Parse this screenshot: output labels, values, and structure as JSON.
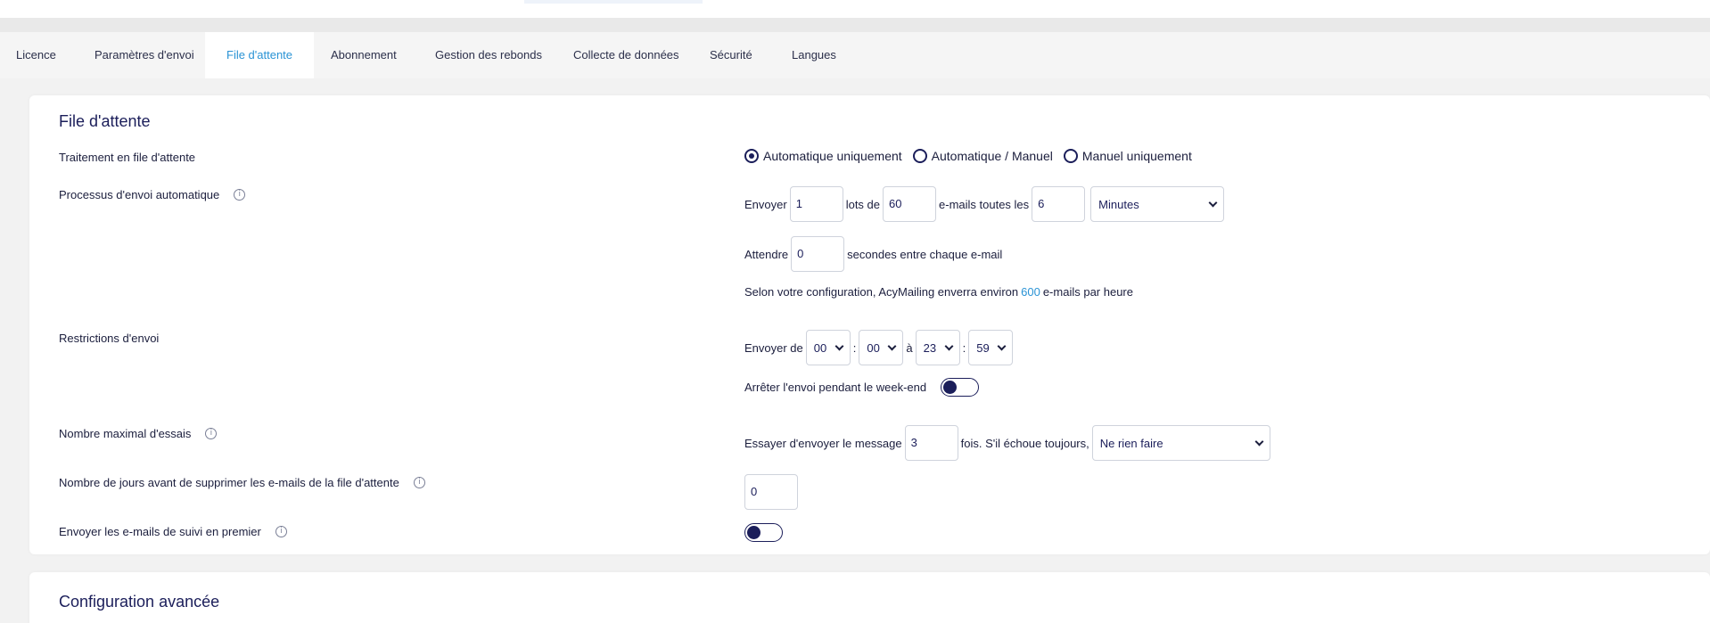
{
  "tabs": [
    {
      "label": "Licence"
    },
    {
      "label": "Paramètres d'envoi"
    },
    {
      "label": "File d'attente"
    },
    {
      "label": "Abonnement"
    },
    {
      "label": "Gestion des rebonds"
    },
    {
      "label": "Collecte de données"
    },
    {
      "label": "Sécurité"
    },
    {
      "label": "Langues"
    }
  ],
  "active_tab": "File d'attente",
  "colors": {
    "accent": "#2a93d5",
    "primary": "#1b1e5a"
  },
  "queue": {
    "title": "File d'attente",
    "processing": {
      "label": "Traitement en file d'attente",
      "options": [
        "Automatique uniquement",
        "Automatique / Manuel",
        "Manuel uniquement"
      ],
      "selected": "Automatique uniquement"
    },
    "auto_process": {
      "label": "Processus d'envoi automatique",
      "send_label": "Envoyer",
      "batches": "1",
      "batches_of_label": "lots de",
      "emails": "60",
      "emails_every_label": "e-mails toutes les",
      "interval": "6",
      "unit": "Minutes",
      "wait_label": "Attendre",
      "wait_seconds": "0",
      "wait_suffix": "secondes entre chaque e-mail",
      "estimate_prefix": "Selon votre configuration, AcyMailing enverra environ",
      "estimate_value": "600",
      "estimate_suffix": "e-mails par heure"
    },
    "restrictions": {
      "label": "Restrictions d'envoi",
      "send_from_label": "Envoyer de",
      "from_hour": "00",
      "from_minute": "00",
      "to_label": "à",
      "to_hour": "23",
      "to_minute": "59",
      "colon": ":",
      "weekend_label": "Arrêter l'envoi pendant le week-end"
    },
    "max_attempts": {
      "label": "Nombre maximal d'essais",
      "try_label": "Essayer d'envoyer le message",
      "attempts": "3",
      "fail_label": "fois. S'il échoue toujours,",
      "action": "Ne rien faire"
    },
    "delete_days": {
      "label": "Nombre de jours avant de supprimer les e-mails de la file d'attente",
      "days": "0"
    },
    "followup_first": {
      "label": "Envoyer les e-mails de suivi en premier"
    }
  },
  "advanced": {
    "title": "Configuration avancée"
  }
}
